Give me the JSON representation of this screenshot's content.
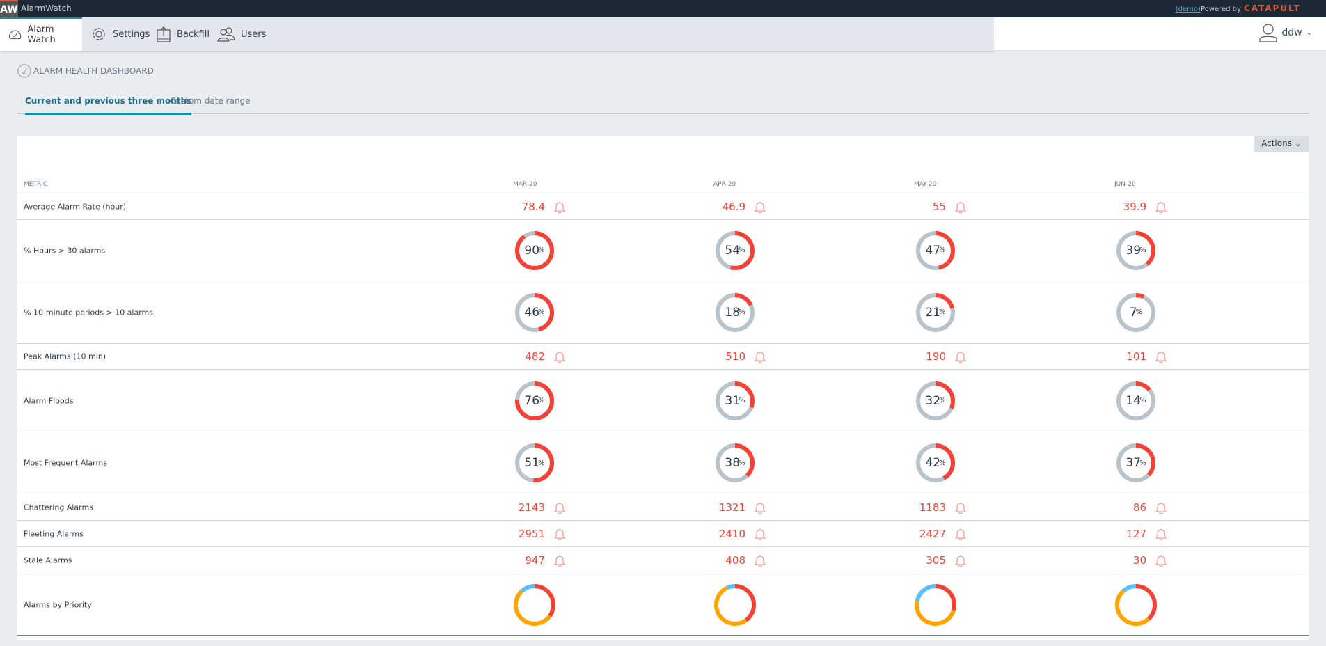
{
  "app": {
    "logo": "AW",
    "title": "AlarmWatch",
    "demo_link": "(demo)",
    "powered_by": "Powered by",
    "brand": "CATAPULT"
  },
  "nav": {
    "items": [
      {
        "label": "Alarm Watch",
        "icon": "gauge-icon"
      },
      {
        "label": "Settings",
        "icon": "gear-icon"
      },
      {
        "label": "Backfill",
        "icon": "upload-icon"
      },
      {
        "label": "Users",
        "icon": "users-icon"
      }
    ],
    "user": "ddw"
  },
  "page": {
    "title": "ALARM HEALTH DASHBOARD",
    "tabs": [
      "Current and previous three months",
      "Custom date range"
    ],
    "actions_label": "Actions"
  },
  "colors": {
    "red": "#f44336",
    "grey": "#b8c3cc",
    "orange": "#ffa400",
    "blue": "#5bc0f8",
    "accent": "#1a88a8"
  },
  "table": {
    "metric_header": "METRIC",
    "months": [
      "MAR-20",
      "APR-20",
      "MAY-20",
      "JUN-20"
    ],
    "rows": [
      {
        "metric": "Average Alarm Rate (hour)",
        "type": "number",
        "values": [
          "78.4",
          "46.9",
          "55",
          "39.9"
        ]
      },
      {
        "metric": "% Hours > 30 alarms",
        "type": "percent",
        "values": [
          90,
          54,
          47,
          39
        ]
      },
      {
        "metric": "% 10-minute periods > 10 alarms",
        "type": "percent",
        "values": [
          46,
          18,
          21,
          7
        ]
      },
      {
        "metric": "Peak Alarms (10 min)",
        "type": "number",
        "values": [
          "482",
          "510",
          "190",
          "101"
        ]
      },
      {
        "metric": "Alarm Floods",
        "type": "percent",
        "values": [
          76,
          31,
          32,
          14
        ]
      },
      {
        "metric": "Most Frequent Alarms",
        "type": "percent",
        "values": [
          51,
          38,
          42,
          37
        ]
      },
      {
        "metric": "Chattering Alarms",
        "type": "number",
        "values": [
          "2143",
          "1321",
          "1183",
          "86"
        ]
      },
      {
        "metric": "Fleeting Alarms",
        "type": "number",
        "values": [
          "2951",
          "2410",
          "2427",
          "127"
        ]
      },
      {
        "metric": "Stale Alarms",
        "type": "number",
        "values": [
          "947",
          "408",
          "305",
          "30"
        ]
      },
      {
        "metric": "Alarms by Priority",
        "type": "priority",
        "values": [
          [
            35,
            53,
            12
          ],
          [
            40,
            53,
            7
          ],
          [
            30,
            48,
            22
          ],
          [
            38,
            50,
            12
          ]
        ]
      }
    ]
  }
}
